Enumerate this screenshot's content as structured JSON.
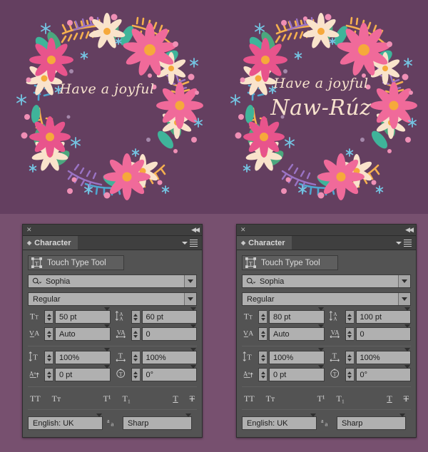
{
  "artwork": {
    "background_color": "#643f60",
    "left": {
      "name": "floral-wreath-card-single-line",
      "lines": [
        "Have a joyful"
      ]
    },
    "right": {
      "name": "floral-wreath-card-two-line",
      "lines": [
        "Have a joyful",
        "Naw-Rúz"
      ]
    },
    "palette": {
      "pink_flower": "#f06a9a",
      "pink_flower_dark": "#e8548c",
      "cream_flower": "#f9e3cb",
      "flower_center": "#f6a93b",
      "leaf_teal": "#3fb49a",
      "leaf_green": "#4ba77e",
      "fern_orange": "#f5b04f",
      "fern_blue": "#4fa6cf",
      "fern_purple": "#9a73c4",
      "dot_pink": "#ef8fb5",
      "snowflake_blue": "#74c4e2",
      "text_cream": "#f7e2cd"
    }
  },
  "page_background": "#77506f",
  "panels": [
    {
      "id": "left",
      "titlebar": {
        "close": "✕",
        "collapse": "◀◀"
      },
      "tab": {
        "label": "Character",
        "grip": "◈"
      },
      "touch_type_tool": {
        "label": "Touch Type Tool",
        "icon": "touch-type-icon"
      },
      "font_family": {
        "value": "Sophia",
        "icon": "search-icon"
      },
      "font_style": {
        "value": "Regular"
      },
      "metrics": {
        "font_size": {
          "icon": "font-size-icon",
          "value": "50 pt"
        },
        "leading": {
          "icon": "leading-icon",
          "value": "60 pt"
        },
        "kerning": {
          "icon": "kerning-icon",
          "value": "Auto"
        },
        "tracking": {
          "icon": "tracking-icon",
          "value": "0"
        },
        "vertical_scale": {
          "icon": "vertical-scale-icon",
          "value": "100%"
        },
        "horizontal_scale": {
          "icon": "horizontal-scale-icon",
          "value": "100%"
        },
        "baseline_shift": {
          "icon": "baseline-shift-icon",
          "value": "0 pt"
        },
        "rotation": {
          "icon": "character-rotation-icon",
          "value": "0°"
        }
      },
      "style_buttons": [
        {
          "name": "all-caps-button",
          "label": "TT"
        },
        {
          "name": "small-caps-button",
          "label": "Tᴛ"
        },
        {
          "name": "superscript-button",
          "label": "T¹"
        },
        {
          "name": "subscript-button",
          "label": "T₁"
        },
        {
          "name": "underline-button",
          "label": "T"
        },
        {
          "name": "strikethrough-button",
          "label": "Ŧ"
        }
      ],
      "language": {
        "value": "English: UK"
      },
      "anti_aliasing": {
        "icon": "anti-aliasing-icon",
        "value": "Sharp"
      }
    },
    {
      "id": "right",
      "titlebar": {
        "close": "✕",
        "collapse": "◀◀"
      },
      "tab": {
        "label": "Character",
        "grip": "◈"
      },
      "touch_type_tool": {
        "label": "Touch Type Tool",
        "icon": "touch-type-icon"
      },
      "font_family": {
        "value": "Sophia",
        "icon": "search-icon"
      },
      "font_style": {
        "value": "Regular"
      },
      "metrics": {
        "font_size": {
          "icon": "font-size-icon",
          "value": "80 pt"
        },
        "leading": {
          "icon": "leading-icon",
          "value": "100 pt"
        },
        "kerning": {
          "icon": "kerning-icon",
          "value": "Auto"
        },
        "tracking": {
          "icon": "tracking-icon",
          "value": "0"
        },
        "vertical_scale": {
          "icon": "vertical-scale-icon",
          "value": "100%"
        },
        "horizontal_scale": {
          "icon": "horizontal-scale-icon",
          "value": "100%"
        },
        "baseline_shift": {
          "icon": "baseline-shift-icon",
          "value": "0 pt"
        },
        "rotation": {
          "icon": "character-rotation-icon",
          "value": "0°"
        }
      },
      "style_buttons": [
        {
          "name": "all-caps-button",
          "label": "TT"
        },
        {
          "name": "small-caps-button",
          "label": "Tᴛ"
        },
        {
          "name": "superscript-button",
          "label": "T¹"
        },
        {
          "name": "subscript-button",
          "label": "T₁"
        },
        {
          "name": "underline-button",
          "label": "T"
        },
        {
          "name": "strikethrough-button",
          "label": "Ŧ"
        }
      ],
      "language": {
        "value": "English: UK"
      },
      "anti_aliasing": {
        "icon": "anti-aliasing-icon",
        "value": "Sharp"
      }
    }
  ]
}
